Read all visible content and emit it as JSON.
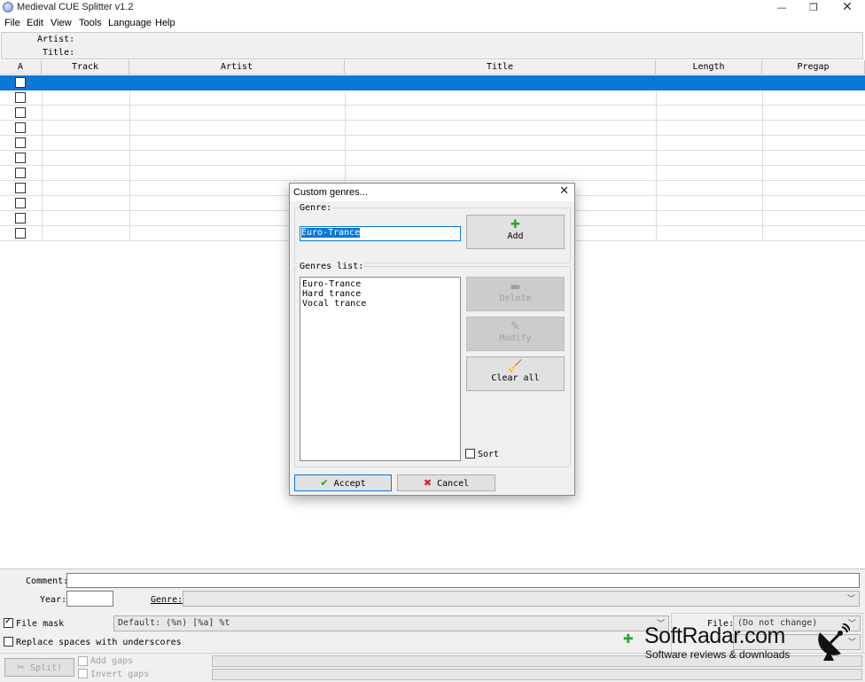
{
  "window": {
    "title": "Medieval CUE Splitter v1.2"
  },
  "menu": [
    "File",
    "Edit",
    "View",
    "Tools",
    "Language",
    "Help"
  ],
  "album": {
    "artist_label": "Artist:",
    "title_label": "Title:"
  },
  "table": {
    "columns": [
      "A",
      "Track",
      "Artist",
      "Title",
      "Length",
      "Pregap"
    ]
  },
  "dialog": {
    "title": "Custom genres...",
    "genre_group_label": "Genre:",
    "genre_value": "Euro-Trance",
    "add_label": "Add",
    "list_group_label": "Genres list:",
    "genres": [
      "Euro-Trance",
      "Hard trance",
      "Vocal trance"
    ],
    "delete_label": "Delete",
    "modify_label": "Modify",
    "clear_label": "Clear all",
    "sort_label": "Sort",
    "accept_label": "Accept",
    "cancel_label": "Cancel"
  },
  "bottom": {
    "comment_label": "Comment:",
    "year_label": "Year:",
    "genre_label": "Genre:",
    "file_mask_label": "File mask",
    "file_mask_checked": true,
    "mask_value": "Default: (%n) [%a] %t",
    "file_label": "File:",
    "file_value": "(Do not change)",
    "replace_label": "Replace spaces with underscores",
    "split_label": "Split!",
    "add_gaps_label": "Add gaps",
    "invert_gaps_label": "Invert gaps"
  },
  "watermark": {
    "title": "SoftRadar.com",
    "subtitle": "Software reviews & downloads"
  },
  "colors": {
    "selection": "#0a78d7",
    "add_icon": "#2aa52a",
    "cancel_icon": "#d42020"
  }
}
